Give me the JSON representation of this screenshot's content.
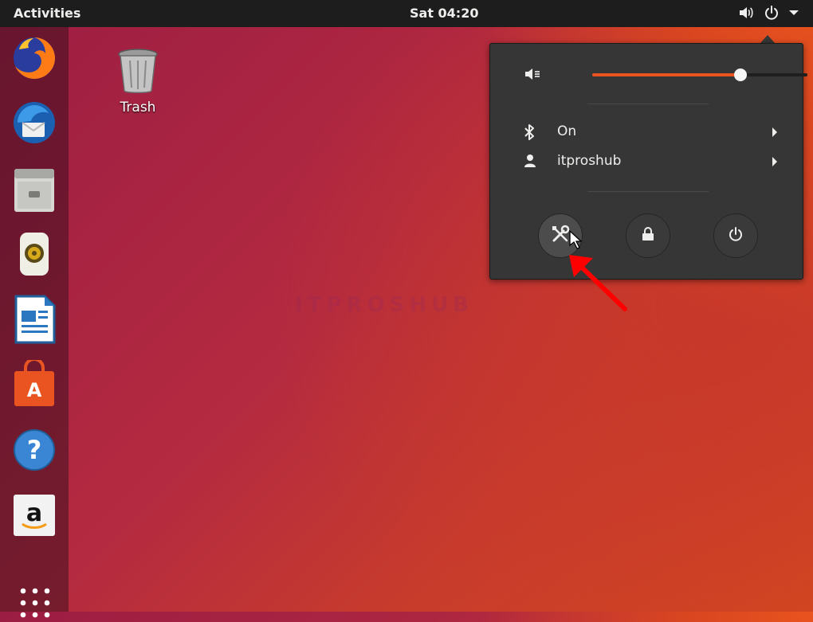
{
  "topbar": {
    "activities_label": "Activities",
    "clock": "Sat 04:20",
    "tray_icons": [
      "volume-icon",
      "power-icon",
      "dropdown-arrow-icon"
    ]
  },
  "dock": {
    "items": [
      {
        "name": "firefox",
        "icon": "firefox-icon"
      },
      {
        "name": "thunderbird",
        "icon": "thunderbird-icon"
      },
      {
        "name": "files",
        "icon": "files-icon"
      },
      {
        "name": "rhythmbox",
        "icon": "rhythmbox-icon"
      },
      {
        "name": "libreoffice-writer",
        "icon": "writer-icon"
      },
      {
        "name": "ubuntu-software",
        "icon": "software-icon"
      },
      {
        "name": "help",
        "icon": "help-icon"
      },
      {
        "name": "amazon",
        "icon": "amazon-icon"
      },
      {
        "name": "show-applications",
        "icon": "app-grid-icon"
      }
    ]
  },
  "desktop": {
    "trash_label": "Trash",
    "watermark": "ITPROSHUB"
  },
  "system_menu": {
    "volume_level": 0.69,
    "bluetooth_label": "On",
    "user_label": "itproshub",
    "buttons": [
      "settings-button",
      "lock-button",
      "power-off-button"
    ]
  },
  "colors": {
    "accent": "#e95420",
    "menu_bg": "#363636",
    "topbar_bg": "#1d1d1d",
    "annotation": "#ff0000"
  }
}
